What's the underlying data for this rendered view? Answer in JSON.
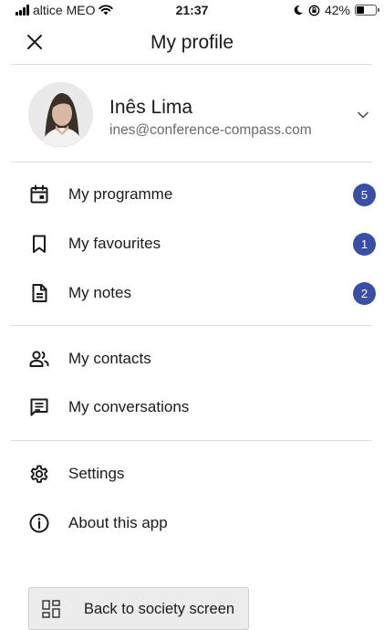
{
  "status_bar": {
    "carrier": "altice MEO",
    "time": "21:37",
    "battery": "42%",
    "battery_level": 0.42
  },
  "header": {
    "title": "My profile",
    "close_icon": "close-icon"
  },
  "profile": {
    "name": "Inês Lima",
    "email": "ines@conference-compass.com",
    "expand_icon": "chevron-down-icon"
  },
  "menu": {
    "programme": {
      "label": "My programme",
      "icon": "calendar-icon",
      "badge": "5"
    },
    "favourites": {
      "label": "My favourites",
      "icon": "bookmark-icon",
      "badge": "1"
    },
    "notes": {
      "label": "My notes",
      "icon": "note-icon",
      "badge": "2"
    },
    "contacts": {
      "label": "My contacts",
      "icon": "contacts-icon"
    },
    "conversations": {
      "label": "My conversations",
      "icon": "chat-icon"
    },
    "settings": {
      "label": "Settings",
      "icon": "gear-icon"
    },
    "about": {
      "label": "About this app",
      "icon": "info-icon"
    }
  },
  "back_button": {
    "label": "Back to society screen",
    "icon": "dashboard-icon"
  },
  "colors": {
    "badge": "#3a4fa2",
    "divider": "#dcdcdc",
    "text": "#1a1a1a",
    "secondary_text": "#6b6b6b",
    "button_bg": "#ececec"
  }
}
